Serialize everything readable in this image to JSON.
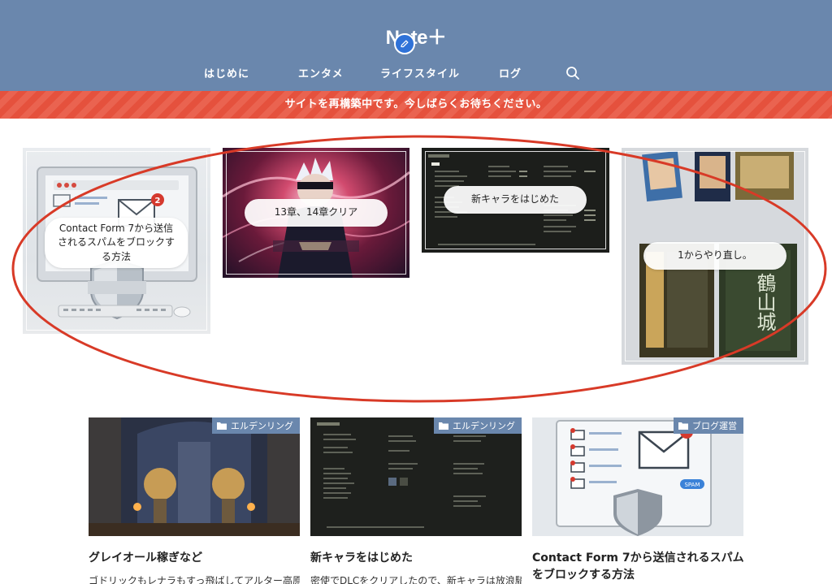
{
  "site": {
    "logo": "Note＋"
  },
  "nav": {
    "items": [
      "はじめに",
      "エンタメ",
      "ライフスタイル",
      "ログ"
    ]
  },
  "notice": {
    "text": "サイトを再構築中です。今しばらくお待ちください。"
  },
  "featured": [
    {
      "label": "Contact Form 7から送信されるスパムをブロックする方法"
    },
    {
      "label": "13章、14章クリア"
    },
    {
      "label": "新キャラをはじめた"
    },
    {
      "label": "1からやり直し。"
    }
  ],
  "posts": [
    {
      "category": "エルデンリング",
      "title": "グレイオール稼ぎなど",
      "excerpt": "ゴドリックもレナラもすっ飛ばしてアルター高原"
    },
    {
      "category": "エルデンリング",
      "title": "新キャラをはじめた",
      "excerpt": "密使でDLCをクリアしたので、新キャラは放浪騎"
    },
    {
      "category": "ブログ運営",
      "title": "Contact Form 7から送信されるスパムをブロックする方法",
      "excerpt": ""
    }
  ],
  "thumb_text": {
    "badge_count": "2",
    "spam_tag": "SPAM",
    "castle_kanji": "鶴山城"
  },
  "colors": {
    "header": "#6a87ad",
    "notice": "#e5513d",
    "ellipse": "#d83a27"
  }
}
